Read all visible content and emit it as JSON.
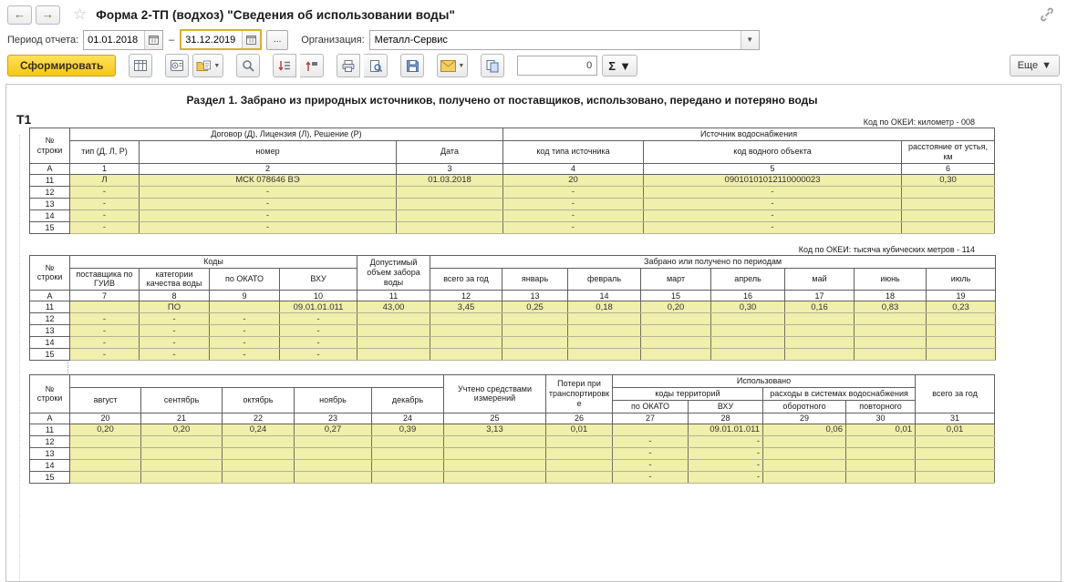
{
  "colors": {
    "accent_yellow": "#f6c71c",
    "row_yellow": "#f0efab",
    "focus_border": "#cfb42c"
  },
  "header": {
    "title": "Форма 2-ТП (водхоз) \"Сведения об использовании воды\""
  },
  "filters": {
    "period_label": "Период отчета:",
    "period_from": "01.01.2018",
    "period_to": "31.12.2019",
    "range_dash": "–",
    "ellipsis_button": "...",
    "org_label": "Организация:",
    "org_value": "Металл-Сервис"
  },
  "toolbar": {
    "generate_label": "Сформировать",
    "counter_value": "0",
    "sigma_label": "Σ",
    "more_label": "Еще",
    "icon_names": [
      "back-icon",
      "forward-icon",
      "star-icon",
      "calendar-icon",
      "link-icon",
      "report-settings-icon",
      "report-variants-icon",
      "open-variant-icon",
      "search-icon",
      "expand-groups-icon",
      "collapse-groups-icon",
      "print-icon",
      "print-preview-icon",
      "save-icon",
      "send-email-icon",
      "copy-icon",
      "sum-icon",
      "chevron-down-icon"
    ]
  },
  "report": {
    "section_title": "Раздел 1. Забрано из природных источников, получено от поставщиков, использовано, передано и потеряно воды",
    "t1_label": "Т1",
    "okei_km": "Код по ОКЕИ: километр - 008",
    "okei_m3": "Код по ОКЕИ: тысяча кубических метров - 114",
    "table1": {
      "rowno_header": "№ строки",
      "group_contract": "Договор (Д), Лицензия (Л), Решение (Р)",
      "group_source": "Источник водоснабжения",
      "cols": [
        "тип (Д, Л, Р)",
        "номер",
        "Дата",
        "код типа источника",
        "код водного объекта",
        "расстояние от устья, км"
      ],
      "index_rows": [
        [
          "А",
          "1",
          "2",
          "3",
          "4",
          "5",
          "6"
        ]
      ],
      "rows": [
        [
          "11",
          "Л",
          "МСК 078646 ВЭ",
          "01.03.2018",
          "20",
          "09010101012110000023",
          "0,30"
        ],
        [
          "12",
          "-",
          "-",
          "",
          "-",
          "-",
          ""
        ],
        [
          "13",
          "-",
          "-",
          "",
          "-",
          "-",
          ""
        ],
        [
          "14",
          "-",
          "-",
          "",
          "-",
          "-",
          ""
        ],
        [
          "15",
          "-",
          "-",
          "",
          "-",
          "-",
          ""
        ]
      ]
    },
    "table2": {
      "rowno_header": "№ строки",
      "group_codes": "Коды",
      "allowed_volume_header": "Допустимый объем забора воды",
      "group_periods": "Забрано или получено по периодам",
      "code_cols": [
        "поставщика по ГУИВ",
        "категории качества воды",
        "по ОКАТО",
        "ВХУ"
      ],
      "period_cols": [
        "всего за год",
        "январь",
        "февраль",
        "март",
        "апрель",
        "май",
        "июнь",
        "июль"
      ],
      "index_rows": [
        [
          "А",
          "7",
          "8",
          "9",
          "10",
          "11",
          "12",
          "13",
          "14",
          "15",
          "16",
          "17",
          "18",
          "19"
        ]
      ],
      "rows": [
        [
          "11",
          "",
          "ПО",
          "",
          "09.01.01.011",
          "43,00",
          "3,45",
          "0,25",
          "0,18",
          "0,20",
          "0,30",
          "0,16",
          "0,83",
          "0,23"
        ],
        [
          "12",
          "-",
          "-",
          "-",
          "-",
          "",
          "",
          "",
          "",
          "",
          "",
          "",
          "",
          ""
        ],
        [
          "13",
          "-",
          "-",
          "-",
          "-",
          "",
          "",
          "",
          "",
          "",
          "",
          "",
          "",
          ""
        ],
        [
          "14",
          "-",
          "-",
          "-",
          "-",
          "",
          "",
          "",
          "",
          "",
          "",
          "",
          "",
          ""
        ],
        [
          "15",
          "-",
          "-",
          "-",
          "-",
          "",
          "",
          "",
          "",
          "",
          "",
          "",
          "",
          ""
        ]
      ]
    },
    "table3": {
      "rowno_header": "№ строки",
      "month_cols": [
        "август",
        "сентябрь",
        "октябрь",
        "ноябрь",
        "декабрь"
      ],
      "measured_header": "Учтено средствами измерений",
      "losses_header": "Потери при транспортировке",
      "group_used": "Использовано",
      "group_territory_codes": "коды территорий",
      "group_supply_costs": "расходы в системах водоснабжения",
      "sub_cols": [
        "по ОКАТО",
        "ВХУ",
        "оборотного",
        "повторного"
      ],
      "total_header": "всего за год",
      "index_rows": [
        [
          "А",
          "20",
          "21",
          "22",
          "23",
          "24",
          "25",
          "26",
          "27",
          "28",
          "29",
          "30",
          "31"
        ]
      ],
      "rows": [
        [
          "11",
          "0,20",
          "0,20",
          "0,24",
          "0,27",
          "0,39",
          "3,13",
          "0,01",
          "",
          "09.01.01.011",
          "0,06",
          "0,01",
          "0,01"
        ],
        [
          "12",
          "",
          "",
          "",
          "",
          "",
          "",
          "",
          "-",
          "-",
          "",
          "",
          ""
        ],
        [
          "13",
          "",
          "",
          "",
          "",
          "",
          "",
          "",
          "-",
          "-",
          "",
          "",
          ""
        ],
        [
          "14",
          "",
          "",
          "",
          "",
          "",
          "",
          "",
          "-",
          "-",
          "",
          "",
          ""
        ],
        [
          "15",
          "",
          "",
          "",
          "",
          "",
          "",
          "",
          "-",
          "-",
          "",
          "",
          ""
        ]
      ]
    }
  }
}
